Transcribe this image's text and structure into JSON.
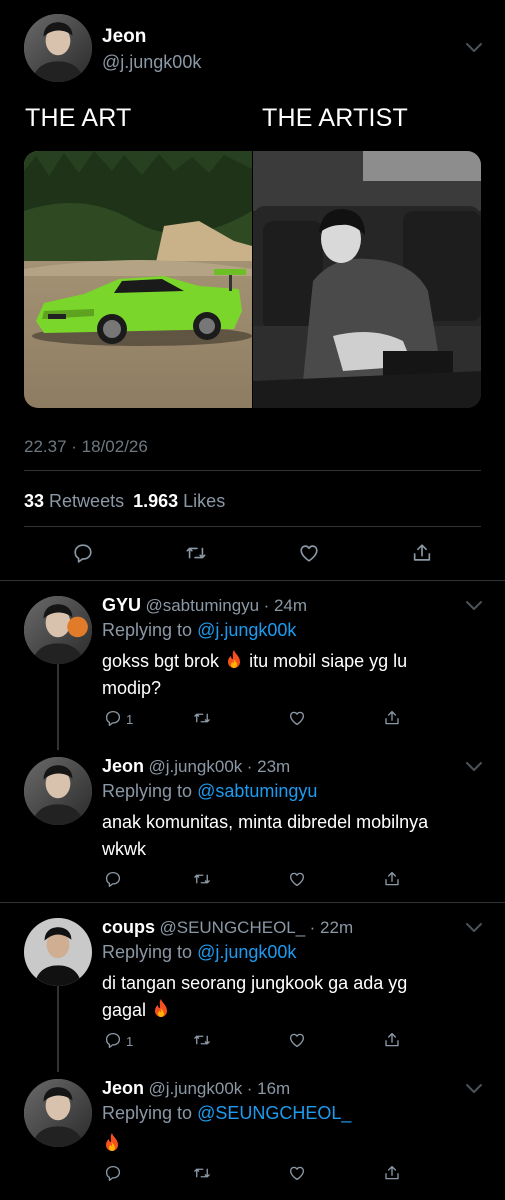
{
  "main_tweet": {
    "name": "Jeon",
    "handle": "@j.jungk00k",
    "text_left": "THE ART",
    "text_right": "THE ARTIST",
    "timestamp": "22.37 · 18/02/26",
    "retweets": "33",
    "retweets_label": "Retweets",
    "likes": "1.963",
    "likes_label": "Likes"
  },
  "replies": [
    {
      "name": "GYU",
      "handle": "@sabtumingyu",
      "time": "· 24m",
      "replying_prefix": "Replying to",
      "replying_to": "@j.jungk00k",
      "text_line1_a": "gokss bgt brok",
      "text_line1_b": "itu mobil siape yg lu",
      "text_line2": "modip?",
      "reply_count": "1"
    },
    {
      "name": "Jeon",
      "handle": "@j.jungk00k",
      "time": "· 23m",
      "replying_prefix": "Replying to",
      "replying_to": "@sabtumingyu",
      "text_line1": "anak komunitas, minta dibredel mobilnya",
      "text_line2": "wkwk"
    },
    {
      "name": "coups",
      "handle": "@SEUNGCHEOL_",
      "time": "· 22m",
      "replying_prefix": "Replying to",
      "replying_to": "@j.jungk00k",
      "text_line1": "di tangan seorang jungkook ga ada yg",
      "text_line2": "gagal",
      "reply_count": "1"
    },
    {
      "name": "Jeon",
      "handle": "@j.jungk00k",
      "time": "· 16m",
      "replying_prefix": "Replying to",
      "replying_to": "@SEUNGCHEOL_"
    }
  ],
  "icons": [
    "reply-icon",
    "retweet-icon",
    "like-icon",
    "share-icon",
    "chevron-down-icon",
    "fire-emoji"
  ],
  "colors": {
    "background": "#000000",
    "link": "#1d9bf0",
    "secondary_text": "#8b98a5",
    "divider": "#2f3336",
    "car_green": "#7ad62a"
  }
}
